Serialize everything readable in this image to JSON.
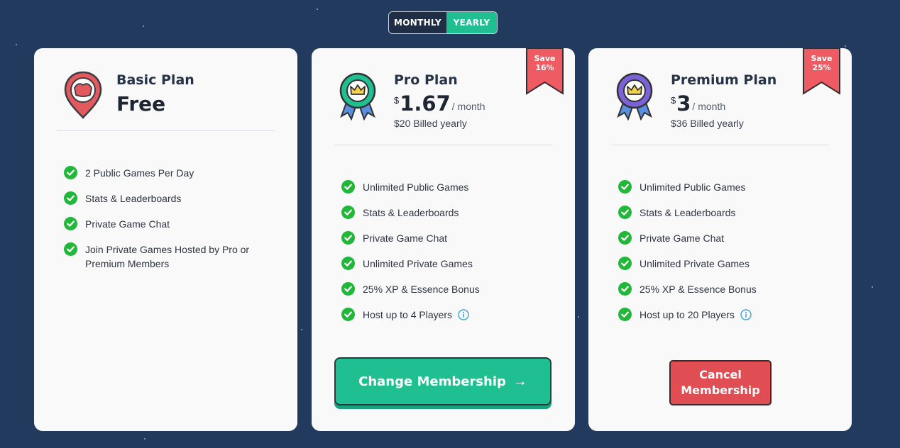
{
  "toggle": {
    "monthly": "MONTHLY",
    "yearly": "YEARLY",
    "selected": "YEARLY"
  },
  "colors": {
    "accent": "#1fbf91",
    "danger": "#e04d52",
    "ribbon": "#ee5b62",
    "background": "#223a5e"
  },
  "plans": [
    {
      "name": "Basic Plan",
      "price_label": "Free",
      "icon": "map-pin-icon",
      "features": [
        "2 Public Games Per Day",
        "Stats & Leaderboards",
        "Private Game Chat",
        "Join Private Games Hosted by Pro or Premium Members"
      ]
    },
    {
      "name": "Pro Plan",
      "currency": "$",
      "price": "1.67",
      "per": "/ month",
      "billed": "$20 Billed yearly",
      "icon": "crown-badge-icon",
      "badge_line1": "Save",
      "badge_line2": "16%",
      "features": [
        "Unlimited Public Games",
        "Stats & Leaderboards",
        "Private Game Chat",
        "Unlimited Private Games",
        "25% XP & Essence Bonus",
        "Host up to 4 Players"
      ],
      "button": "Change Membership",
      "button_arrow": "→"
    },
    {
      "name": "Premium Plan",
      "currency": "$",
      "price": "3",
      "per": "/ month",
      "billed": "$36 Billed yearly",
      "icon": "crown-badge-icon",
      "badge_line1": "Save",
      "badge_line2": "25%",
      "features": [
        "Unlimited Public Games",
        "Stats & Leaderboards",
        "Private Game Chat",
        "Unlimited Private Games",
        "25% XP & Essence Bonus",
        "Host up to 20 Players"
      ],
      "button": "Cancel Membership"
    }
  ]
}
